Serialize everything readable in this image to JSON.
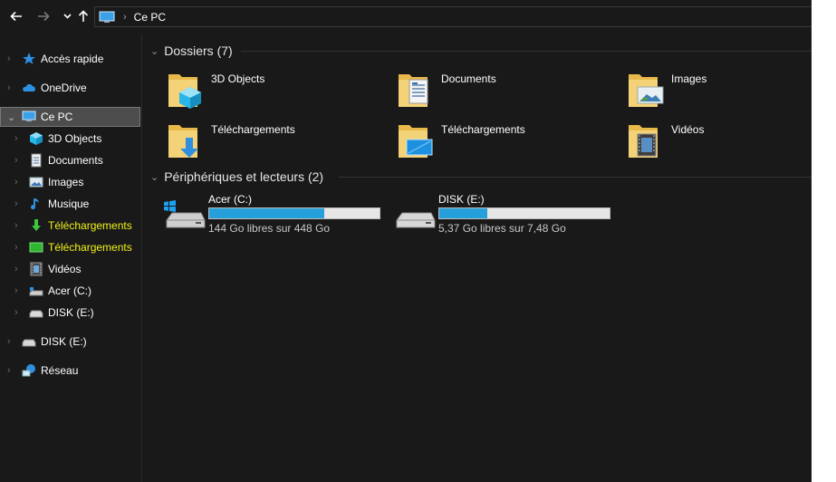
{
  "toolbar": {
    "back_icon": "arrow-left-icon",
    "forward_icon": "arrow-right-icon",
    "recent_icon": "chevron-down-icon",
    "up_icon": "arrow-up-icon",
    "address": {
      "icon": "computer-icon",
      "separator": "›",
      "path": "Ce PC"
    }
  },
  "sidebar": {
    "items": [
      {
        "label": "Accès rapide",
        "icon": "star-icon"
      },
      {
        "label": "OneDrive",
        "icon": "cloud-icon"
      },
      {
        "label": "Ce PC",
        "icon": "computer-icon",
        "selected": true
      },
      {
        "label": "3D Objects",
        "icon": "cube-icon"
      },
      {
        "label": "Documents",
        "icon": "document-icon"
      },
      {
        "label": "Images",
        "icon": "picture-icon"
      },
      {
        "label": "Musique",
        "icon": "music-note-icon"
      },
      {
        "label": "Téléchargements",
        "icon": "download-arrow-icon",
        "highlight": true
      },
      {
        "label": "Téléchargements",
        "icon": "green-folder-icon",
        "highlight": true
      },
      {
        "label": "Vidéos",
        "icon": "film-icon"
      },
      {
        "label": "Acer (C:)",
        "icon": "drive-icon"
      },
      {
        "label": "DISK (E:)",
        "icon": "drive-icon"
      },
      {
        "label": "DISK (E:)",
        "icon": "drive-icon"
      },
      {
        "label": "Réseau",
        "icon": "network-icon"
      }
    ]
  },
  "content": {
    "folders_group": {
      "title": "Dossiers (7)",
      "folders": [
        {
          "label": "3D Objects",
          "icon": "folder-3d-objects-icon"
        },
        {
          "label": "Documents",
          "icon": "folder-documents-icon"
        },
        {
          "label": "Images",
          "icon": "folder-images-icon"
        },
        {
          "label": "Téléchargements",
          "icon": "folder-downloads-icon"
        },
        {
          "label": "Téléchargements",
          "icon": "folder-desktop-icon"
        },
        {
          "label": "Vidéos",
          "icon": "folder-videos-icon"
        }
      ]
    },
    "drives_group": {
      "title": "Périphériques et lecteurs (2)",
      "drives": [
        {
          "label": "Acer (C:)",
          "free_text": "144 Go libres sur 448 Go",
          "used_fraction": 0.678,
          "icon": "windows-drive-icon"
        },
        {
          "label": "DISK (E:)",
          "free_text": "5,37 Go libres sur 7,48 Go",
          "used_fraction": 0.282,
          "icon": "removable-drive-icon"
        }
      ]
    }
  },
  "colors": {
    "background": "#191919",
    "selection": "#4d4d4d",
    "highlight_text": "#f1f11a",
    "progress_fill": "#26a0da",
    "progress_track": "#e6e6e6"
  }
}
